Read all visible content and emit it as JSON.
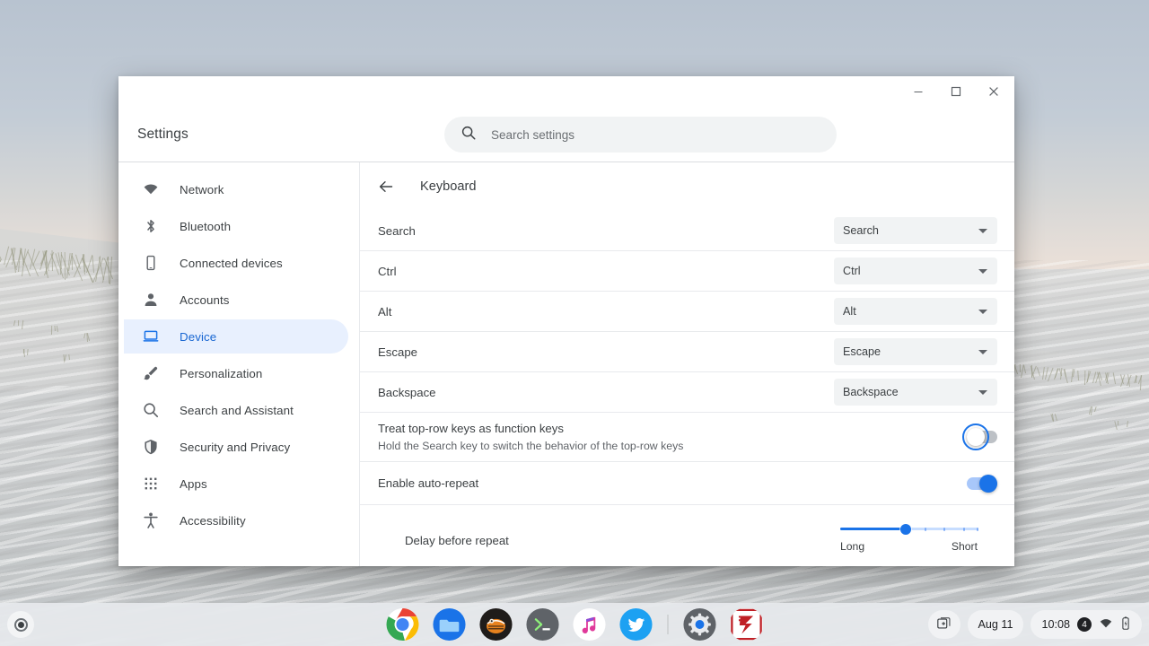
{
  "window": {
    "controls": {
      "minimize": "Minimize",
      "maximize": "Maximize",
      "close": "Close"
    }
  },
  "header": {
    "title": "Settings",
    "search_placeholder": "Search settings",
    "search_value": ""
  },
  "sidebar": {
    "items": [
      {
        "label": "Network",
        "icon": "wifi-icon",
        "selected": false
      },
      {
        "label": "Bluetooth",
        "icon": "bluetooth-icon",
        "selected": false
      },
      {
        "label": "Connected devices",
        "icon": "phone-icon",
        "selected": false
      },
      {
        "label": "Accounts",
        "icon": "person-icon",
        "selected": false
      },
      {
        "label": "Device",
        "icon": "laptop-icon",
        "selected": true
      },
      {
        "label": "Personalization",
        "icon": "brush-icon",
        "selected": false
      },
      {
        "label": "Search and Assistant",
        "icon": "search-icon",
        "selected": false
      },
      {
        "label": "Security and Privacy",
        "icon": "shield-icon",
        "selected": false
      },
      {
        "label": "Apps",
        "icon": "grid-icon",
        "selected": false
      },
      {
        "label": "Accessibility",
        "icon": "accessibility-icon",
        "selected": false
      }
    ]
  },
  "content": {
    "back_label": "Back",
    "title": "Keyboard",
    "key_rows": [
      {
        "label": "Search",
        "value": "Search"
      },
      {
        "label": "Ctrl",
        "value": "Ctrl"
      },
      {
        "label": "Alt",
        "value": "Alt"
      },
      {
        "label": "Escape",
        "value": "Escape"
      },
      {
        "label": "Backspace",
        "value": "Backspace"
      }
    ],
    "function_keys": {
      "title": "Treat top-row keys as function keys",
      "subtitle": "Hold the Search key to switch the behavior of the top-row keys",
      "state": "off"
    },
    "auto_repeat": {
      "title": "Enable auto-repeat",
      "state": "on"
    },
    "delay_slider": {
      "label": "Delay before repeat",
      "min_label": "Long",
      "max_label": "Short",
      "value_percent": 48
    }
  },
  "shelf": {
    "launcher_label": "Launcher",
    "apps": [
      {
        "name": "chrome",
        "label": "Chrome",
        "running": true
      },
      {
        "name": "files",
        "label": "Files",
        "running": false
      },
      {
        "name": "unknown-app",
        "label": "App",
        "running": true
      },
      {
        "name": "terminal",
        "label": "Terminal",
        "running": true
      },
      {
        "name": "music",
        "label": "Music",
        "running": false
      },
      {
        "name": "twitter",
        "label": "Twitter",
        "running": false
      },
      {
        "name": "settings",
        "label": "Settings",
        "running": true
      },
      {
        "name": "filezilla",
        "label": "FileZilla",
        "running": false
      }
    ],
    "status": {
      "desk_label": "New desk",
      "date": "Aug 11",
      "time": "10:08",
      "notification_count": "4",
      "network": "wifi-icon",
      "battery": "battery-icon"
    }
  },
  "colors": {
    "accent": "#1a73e8",
    "selected_nav_bg": "#e8f0fe",
    "dropdown_bg": "#f1f3f4",
    "text_primary": "#3c4043",
    "text_secondary": "#5f6368"
  }
}
